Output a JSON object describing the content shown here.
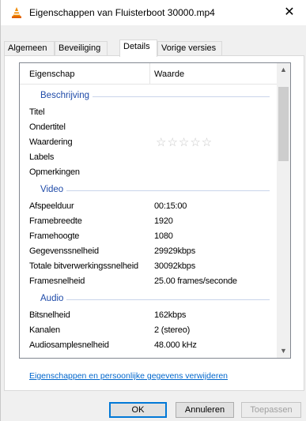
{
  "window": {
    "title": "Eigenschappen van Fluisterboot 30000.mp4",
    "app_icon": "vlc-cone-icon",
    "close_glyph": "✕"
  },
  "tabs": [
    {
      "label": "Algemeen",
      "active": false
    },
    {
      "label": "Beveiliging",
      "active": false
    },
    {
      "label": "Details",
      "active": true
    },
    {
      "label": "Vorige versies",
      "active": false
    }
  ],
  "list": {
    "col_name": "Eigenschap",
    "col_value": "Waarde",
    "groups": {
      "description": "Beschrijving",
      "video": "Video",
      "audio": "Audio"
    },
    "description_rows": [
      {
        "name": "Titel",
        "value": ""
      },
      {
        "name": "Ondertitel",
        "value": ""
      },
      {
        "name": "Waardering",
        "value": "☆☆☆☆☆"
      },
      {
        "name": "Labels",
        "value": ""
      },
      {
        "name": "Opmerkingen",
        "value": ""
      }
    ],
    "video_rows": [
      {
        "name": "Afspeelduur",
        "value": "00:15:00"
      },
      {
        "name": "Framebreedte",
        "value": "1920"
      },
      {
        "name": "Framehoogte",
        "value": "1080"
      },
      {
        "name": "Gegevenssnelheid",
        "value": "29929kbps"
      },
      {
        "name": "Totale bitverwerkingssnelheid",
        "value": "30092kbps"
      },
      {
        "name": "Framesnelheid",
        "value": "25.00 frames/seconde"
      }
    ],
    "audio_rows": [
      {
        "name": "Bitsnelheid",
        "value": "162kbps"
      },
      {
        "name": "Kanalen",
        "value": "2 (stereo)"
      },
      {
        "name": "Audiosamplesnelheid",
        "value": "48.000 kHz"
      }
    ]
  },
  "link_text": "Eigenschappen en persoonlijke gegevens verwijderen",
  "buttons": {
    "ok": "OK",
    "cancel": "Annuleren",
    "apply": "Toepassen"
  }
}
